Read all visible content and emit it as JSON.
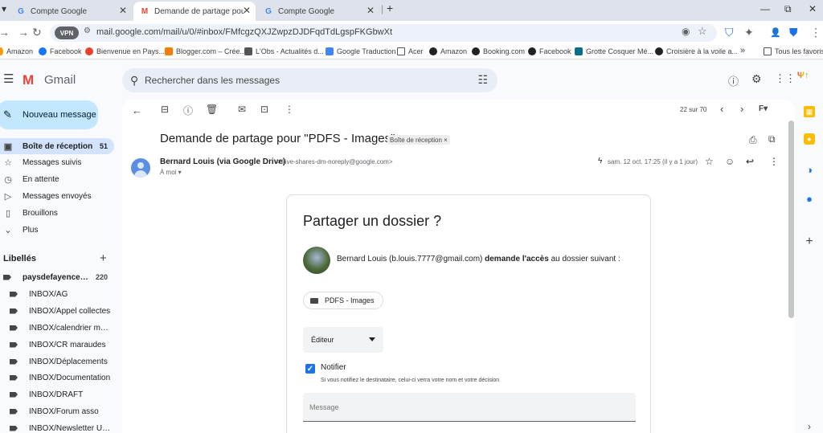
{
  "browser": {
    "tabs": [
      {
        "title": "Compte Google",
        "active": false
      },
      {
        "title": "Demande de partage pour \"PDF",
        "active": true
      },
      {
        "title": "Compte Google",
        "active": false
      }
    ],
    "new_tab_symbol": "+",
    "vpn_label": "VPN",
    "url": "mail.google.com/mail/u/0/#inbox/FMfcgzQXJZwpzDJDFqdTdLgspFKGbwXt",
    "bookmarks": [
      "Amazon",
      "Facebook",
      "Bienvenue en Pays...",
      "Blogger.com – Crée...",
      "L'Obs - Actualités d...",
      "Google Traduction",
      "Acer",
      "Amazon",
      "Booking.com",
      "Facebook",
      "Grotte Cosquer Mé...",
      "Croisière à la voile a..."
    ],
    "bookmarks_overflow": "»",
    "all_bookmarks": "Tous les favoris"
  },
  "gmail": {
    "logo_text": "Gmail",
    "search_placeholder": "Rechercher dans les messages",
    "compose_label": "Nouveau message",
    "nav": [
      {
        "label": "Boîte de réception",
        "count": "51",
        "icon": "inbox-icon",
        "active": true
      },
      {
        "label": "Messages suivis",
        "count": "",
        "icon": "star-icon",
        "active": false
      },
      {
        "label": "En attente",
        "count": "",
        "icon": "clock-icon",
        "active": false
      },
      {
        "label": "Messages envoyés",
        "count": "",
        "icon": "send-icon",
        "active": false
      },
      {
        "label": "Brouillons",
        "count": "",
        "icon": "draft-icon",
        "active": false
      },
      {
        "label": "Plus",
        "count": "",
        "icon": "chevron-down-icon",
        "active": false
      }
    ],
    "labels_title": "Libellés",
    "labels": [
      {
        "name": "paysdefayences...",
        "count": "220",
        "bold": true
      },
      {
        "name": "INBOX/AG",
        "count": ""
      },
      {
        "name": "INBOX/Appel collectes",
        "count": ""
      },
      {
        "name": "INBOX/calendrier mar...",
        "count": ""
      },
      {
        "name": "INBOX/CR maraudes",
        "count": ""
      },
      {
        "name": "INBOX/Déplacements",
        "count": ""
      },
      {
        "name": "INBOX/Documentation",
        "count": ""
      },
      {
        "name": "INBOX/DRAFT",
        "count": ""
      },
      {
        "name": "INBOX/Forum asso",
        "count": ""
      },
      {
        "name": "INBOX/Newsletter Ukr...",
        "count": ""
      }
    ]
  },
  "message": {
    "pager": "22 sur 70",
    "subject": "Demande de partage pour \"PDFS - Images\"",
    "inbox_chip": "Boîte de réception ×",
    "sender_name": "Bernard Louis (via Google Drive)",
    "sender_email": "<drive-shares-dm-noreply@google.com>",
    "to": "À moi",
    "date": "sam. 12 oct. 17:25 (il y a 1 jour)"
  },
  "share_request": {
    "title": "Partager un dossier ?",
    "requester": "Bernard Louis (b.louis.7777@gmail.com)",
    "request_bold": "demande l'accès",
    "request_tail": "au dossier suivant :",
    "folder_name": "PDFS - Images",
    "role": "Éditeur",
    "notify_label": "Notifier",
    "notify_checked": true,
    "notify_hint": "Si vous notifiez le destinataire, celui-ci verra votre nom et votre décision",
    "message_placeholder": "Message"
  },
  "colors": {
    "compose_bg": "#c2e7ff",
    "active_nav_bg": "#d3e3fd",
    "checkbox": "#1a73e8",
    "gmail_red": "#ea4335"
  }
}
